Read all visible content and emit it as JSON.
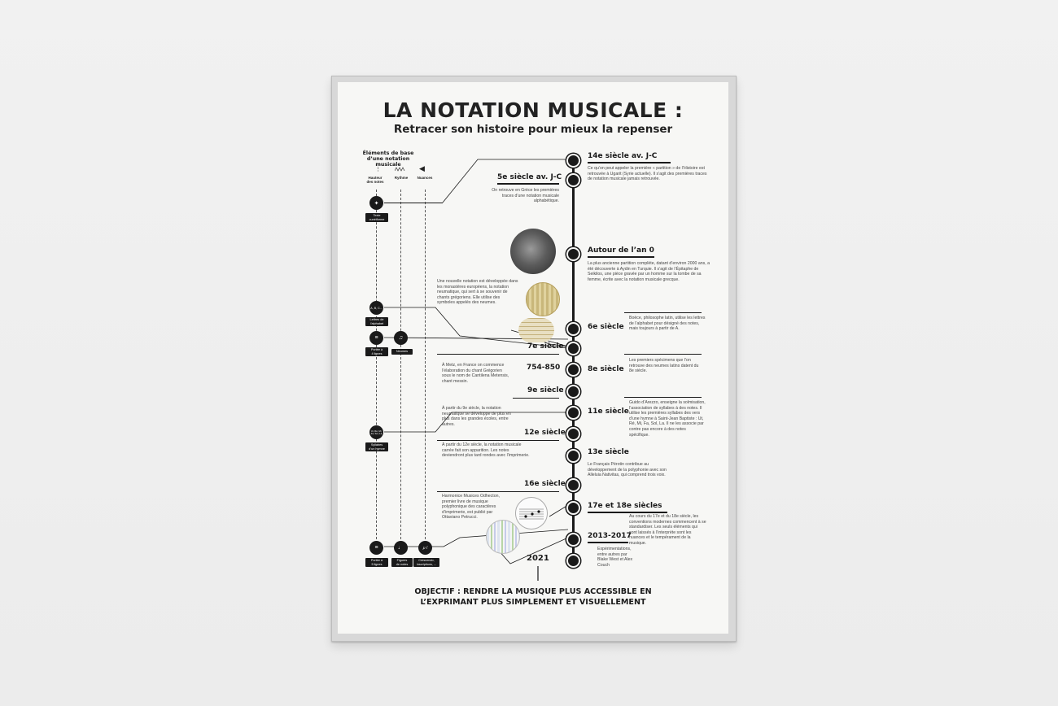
{
  "poster": {
    "title": "LA NOTATION MUSICALE :",
    "subtitle": "Retracer son histoire pour mieux la repenser",
    "objective_line1": "OBJECTIF : RENDRE LA MUSIQUE PLUS ACCESSIBLE EN",
    "objective_line2": "L’EXPRIMANT PLUS SIMPLEMENT ET VISUELLEMENT"
  },
  "base_elements": {
    "heading_line1": "Éléments de base",
    "heading_line2": "d’une notation musicale",
    "col1_line1": "Hauteur",
    "col1_line2": "des notes",
    "col2": "Rythme",
    "col3": "Nuances"
  },
  "left_icons": {
    "texte_line1": "Texte",
    "texte_line2": "cunéiforme",
    "lettres_icon": "A, B, C...",
    "lettres_line1": "Lettres de",
    "lettres_line2": "l’alphabet",
    "portee4_line1": "Portée à",
    "portee4_line2": "4 lignes",
    "neumes": "Neumes",
    "syllabes_icon": "Ut, Ré, Mi, Fa, Sol, La",
    "syllabes_line1": "Syllabes",
    "syllabes_line2": "d’un hymne",
    "portee5_line1": "Portée à",
    "portee5_line2": "5 lignes",
    "figures_line1": "Figures",
    "figures_line2": "de notes",
    "crescendo_line1": "Crescendo,",
    "crescendo_line2": "inscriptions, ...",
    "dynamic_icon": "p f"
  },
  "timeline": {
    "e14av": {
      "label": "14e siècle av. J-C",
      "desc": "Ce qu’on peut appeler la première « partition » de l’Histoire est retrouvée à Ugarit (Syrie actuelle). Il s’agit des premières traces de notation musicale jamais retrouvée."
    },
    "e5av": {
      "label": "5e siècle av. J-C",
      "desc": "On retrouve en Grèce les premières traces d’une notation musicale alphabétique."
    },
    "an0": {
      "label": "Autour de l’an 0",
      "desc": "La plus ancienne partition complète, datant d’environ 2000 ans, a été découverte à Aydin en Turquie. Il s’agit de l’Épitaphe de Seikilos, une pièce gravée par un homme sur la tombe de sa femme, écrite avec la notation musicale grecque."
    },
    "neum": {
      "desc": "Une nouvelle notation est développée dans les monastères européens, la notation neumatique, qui sert à se souvenir de chants grégoriens. Elle utilise des symboles appelés des neumes."
    },
    "e6": {
      "label": "6e siècle",
      "desc": "Boèce, philosophe latin, utilise les lettres de l’alphabet pour désigné des notes, mais toujours à partir de A."
    },
    "e7": {
      "label": "7e siècle"
    },
    "e754": {
      "label": "754-850",
      "desc": "À Metz, en France on commence l’élaboration du chant Grégorien sous le nom de Cantilena Metensis, chant messin."
    },
    "e8": {
      "label": "8e siècle",
      "desc": "Les premiers spécimens que l’on retrouve des neumes latins datent du 8e siècle."
    },
    "e9": {
      "label": "9e siècle",
      "desc": "À partir du 9e siècle, la notation neumatique se développe de plus en plus dans les grandes écoles, entre autres."
    },
    "e11": {
      "label": "11e siècle",
      "desc": "Guido d’Arezzo, enseigne la solmisation, l’association de syllabes à des notes. Il utilise les premières syllabes des vers d’une hymne à Saint-Jean Baptiste : Ut, Ré, Mi, Fa, Sol, La. Il ne les associe par contre pas encore à des notes spécifique."
    },
    "e12": {
      "label": "12e siècle",
      "desc": "À partir du 12e siècle, la notation musicale carrée fait son apparition. Les notes deviendront plus tard rondes avec l’imprimerie."
    },
    "e13": {
      "label": "13e siècle",
      "desc": "Le Français Pérotin contribue au développement de la polyphonie avec son Alleluia Nativitas, qui comprend trois voix."
    },
    "e16": {
      "label": "16e siècle",
      "desc": "Harmonice Musices Odhecton, premier livre de musique polyphonique des caractères d’imprimerie, est publié par Ottaviano Petrucci."
    },
    "e17": {
      "label": "17e et 18e siècles",
      "desc": "Au cours du 17e et du 18e siècle, les conventions modernes commencent à se standardiser. Les seuls éléments qui sont laissés à l’interprète sont les nuances et le tempérament de la musique."
    },
    "e2013": {
      "label": "2013-2017",
      "desc": "Expérimentations, entre autres par Blake West et Alex Couch"
    },
    "e2021": {
      "label": "2021"
    }
  },
  "colors": {
    "ink": "#1a1a1a",
    "paper": "#f7f7f5",
    "wall": "#eeeeee"
  }
}
